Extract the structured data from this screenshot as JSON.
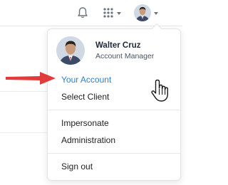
{
  "topbar": {
    "icons": [
      "bell-icon",
      "apps-grid-icon",
      "chevron-down-icon",
      "avatar"
    ]
  },
  "user": {
    "name": "Walter Cruz",
    "role": "Account Manager"
  },
  "menu": {
    "your_account": "Your Account",
    "select_client": "Select Client",
    "impersonate": "Impersonate",
    "administration": "Administration",
    "sign_out": "Sign out"
  },
  "colors": {
    "link_active": "#2f80c7",
    "annotation_arrow": "#e23b3b"
  }
}
